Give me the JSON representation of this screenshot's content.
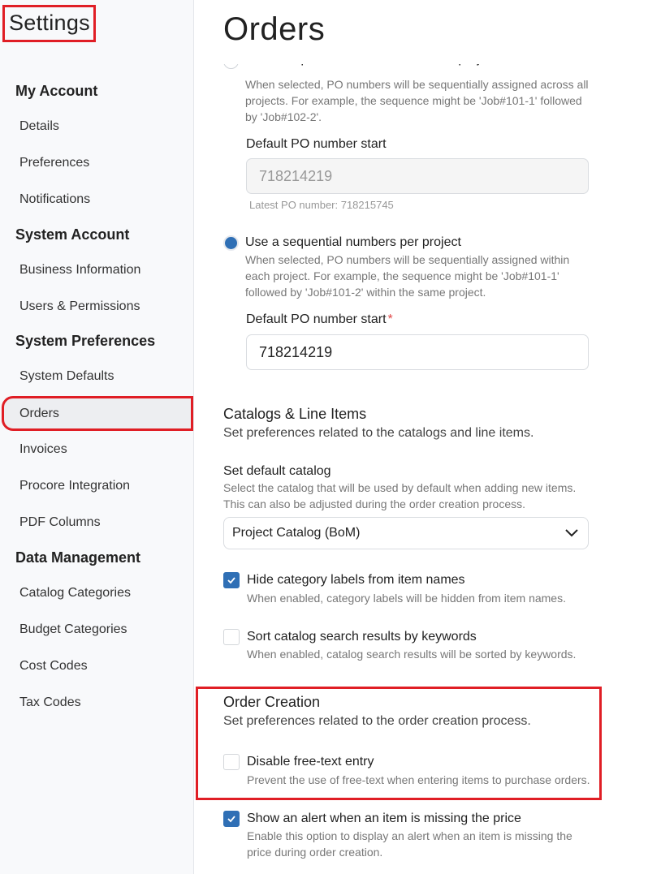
{
  "sidebar": {
    "title": "Settings",
    "sections": [
      {
        "label": "My Account",
        "items": [
          "Details",
          "Preferences",
          "Notifications"
        ]
      },
      {
        "label": "System Account",
        "items": [
          "Business Information",
          "Users & Permissions"
        ]
      },
      {
        "label": "System Preferences",
        "items": [
          "System Defaults",
          "Orders",
          "Invoices",
          "Procore Integration",
          "PDF Columns"
        ]
      },
      {
        "label": "Data Management",
        "items": [
          "Catalog Categories",
          "Budget Categories",
          "Cost Codes",
          "Tax Codes"
        ]
      }
    ],
    "active_item": "Orders"
  },
  "main": {
    "title": "Orders",
    "po_numbering": {
      "option_global": {
        "label": "Use a sequential numbers across all projects",
        "description": "When selected, PO numbers will be sequentially assigned across all projects. For example, the sequence might be 'Job#101-1' followed by 'Job#102-2'.",
        "selected": false,
        "field_label": "Default PO number start",
        "field_value": "718214219",
        "helper": "Latest PO number: 718215745"
      },
      "option_per_project": {
        "label": "Use a sequential numbers per project",
        "description": "When selected, PO numbers will be sequentially assigned within each project. For example, the sequence might be 'Job#101-1' followed by 'Job#101-2' within the same project.",
        "selected": true,
        "field_label": "Default PO number start",
        "required_mark": "*",
        "field_value": "718214219"
      }
    },
    "catalogs": {
      "title": "Catalogs & Line Items",
      "description": "Set preferences related to the catalogs and line items.",
      "default_catalog_label": "Set default catalog",
      "default_catalog_desc": "Select the catalog that will be used by default when adding new items. This can also be adjusted during the order creation process.",
      "default_catalog_value": "Project Catalog (BoM)",
      "hide_category": {
        "label": "Hide category labels from item names",
        "description": "When enabled, category labels will be hidden from item names.",
        "checked": true
      },
      "sort_keywords": {
        "label": "Sort catalog search results by keywords",
        "description": "When enabled, catalog search results will be sorted by keywords.",
        "checked": false
      }
    },
    "order_creation": {
      "title": "Order Creation",
      "description": "Set preferences related to the order creation process.",
      "disable_free_text": {
        "label": "Disable free-text entry",
        "description": "Prevent the use of free-text when entering items to purchase orders.",
        "checked": false
      },
      "missing_price_alert": {
        "label": "Show an alert when an item is missing the price",
        "description": "Enable this option to display an alert when an item is missing the price during order creation.",
        "checked": true
      }
    }
  },
  "colors": {
    "accent": "#2f6fb5",
    "highlight": "#e01e25"
  }
}
